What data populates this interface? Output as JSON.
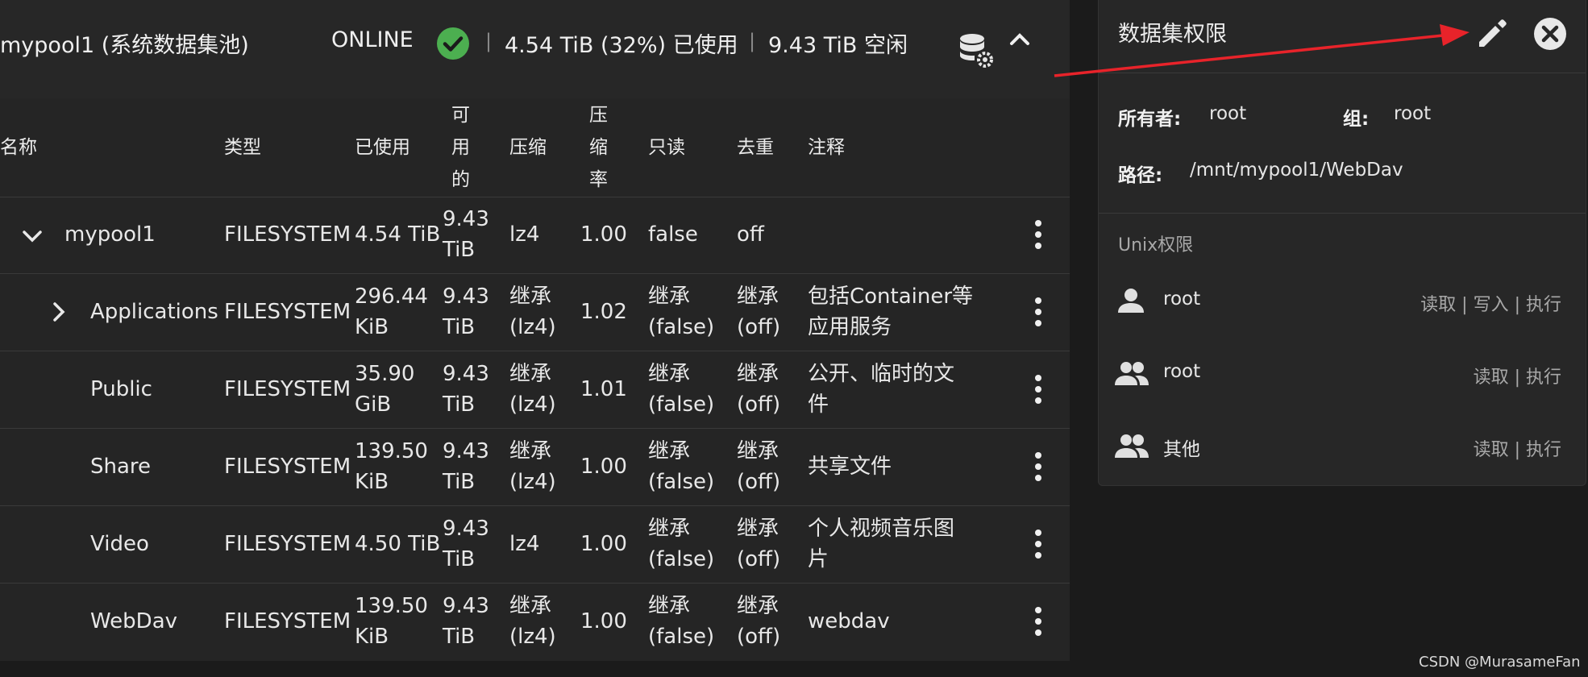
{
  "pool": {
    "name": "mypool1   (系统数据集池)",
    "status": "ONLINE",
    "used": "4.54 TiB (32%) 已使用",
    "free": "9.43 TiB 空闲",
    "separator": "|"
  },
  "columns": {
    "name": "名称",
    "type": "类型",
    "used": "已使用",
    "available": [
      "可",
      "用",
      "的"
    ],
    "compression": "压缩",
    "ratio": [
      "压",
      "缩",
      "率"
    ],
    "readonly": "只读",
    "dedup": "去重",
    "comments": "注释"
  },
  "rows": [
    {
      "name": "mypool1",
      "type": "FILESYSTEM",
      "used": [
        "4.54 TiB"
      ],
      "available": [
        "9.43",
        "TiB"
      ],
      "compression": [
        "lz4"
      ],
      "ratio": "1.00",
      "readonly": [
        "false"
      ],
      "dedup": [
        "off"
      ],
      "comments": [
        ""
      ]
    },
    {
      "name": "Applications",
      "type": "FILESYSTEM",
      "used": [
        "296.44",
        "KiB"
      ],
      "available": [
        "9.43",
        "TiB"
      ],
      "compression": [
        "继承",
        "(lz4)"
      ],
      "ratio": "1.02",
      "readonly": [
        "继承",
        "(false)"
      ],
      "dedup": [
        "继承",
        "(off)"
      ],
      "comments": [
        "包括Container等",
        "应用服务"
      ]
    },
    {
      "name": "Public",
      "type": "FILESYSTEM",
      "used": [
        "35.90",
        "GiB"
      ],
      "available": [
        "9.43",
        "TiB"
      ],
      "compression": [
        "继承",
        "(lz4)"
      ],
      "ratio": "1.01",
      "readonly": [
        "继承",
        "(false)"
      ],
      "dedup": [
        "继承",
        "(off)"
      ],
      "comments": [
        "公开、临时的文",
        "件"
      ]
    },
    {
      "name": "Share",
      "type": "FILESYSTEM",
      "used": [
        "139.50",
        "KiB"
      ],
      "available": [
        "9.43",
        "TiB"
      ],
      "compression": [
        "继承",
        "(lz4)"
      ],
      "ratio": "1.00",
      "readonly": [
        "继承",
        "(false)"
      ],
      "dedup": [
        "继承",
        "(off)"
      ],
      "comments": [
        "共享文件"
      ]
    },
    {
      "name": "Video",
      "type": "FILESYSTEM",
      "used": [
        "4.50 TiB"
      ],
      "available": [
        "9.43",
        "TiB"
      ],
      "compression": [
        "lz4"
      ],
      "ratio": "1.00",
      "readonly": [
        "继承",
        "(false)"
      ],
      "dedup": [
        "继承",
        "(off)"
      ],
      "comments": [
        "个人视频音乐图",
        "片"
      ]
    },
    {
      "name": "WebDav",
      "type": "FILESYSTEM",
      "used": [
        "139.50",
        "KiB"
      ],
      "available": [
        "9.43",
        "TiB"
      ],
      "compression": [
        "继承",
        "(lz4)"
      ],
      "ratio": "1.00",
      "readonly": [
        "继承",
        "(false)"
      ],
      "dedup": [
        "继承",
        "(off)"
      ],
      "comments": [
        "webdav"
      ]
    }
  ],
  "panel": {
    "title": "数据集权限",
    "owner_label": "所有者:",
    "owner": "root",
    "group_label": "组:",
    "group": "root",
    "path_label": "路径:",
    "path": "/mnt/mypool1/WebDav",
    "unix_title": "Unix权限",
    "perms": [
      {
        "icon": "user-icon",
        "name": "root",
        "flags": "读取 | 写入 | 执行"
      },
      {
        "icon": "group-icon",
        "name": "root",
        "flags": "读取 | 执行"
      },
      {
        "icon": "group-icon",
        "name": "其他",
        "flags": "读取 | 执行"
      }
    ]
  },
  "watermark": "CSDN @MurasameFan",
  "colors": {
    "accent_green": "#4caf50",
    "arrow_red": "#e8232a"
  }
}
